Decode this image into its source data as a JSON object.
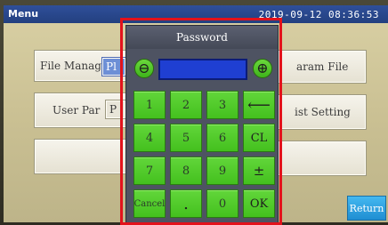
{
  "window": {
    "title": "Menu",
    "clock": "2019-09-12 08:36:53"
  },
  "menu": {
    "file_manager_label": "File Manag",
    "param_file_label": "aram File",
    "user_param_label": "User Par",
    "list_setting_label": "ist Setting",
    "return_label": "Return",
    "peek_label_1": "Pl",
    "peek_label_2": "P"
  },
  "password_dialog": {
    "title": "Password",
    "minus_symbol": "⊖",
    "plus_symbol": "⊕",
    "value": "",
    "keys": {
      "k1": "1",
      "k2": "2",
      "k3": "3",
      "backspace": "⟵",
      "k4": "4",
      "k5": "5",
      "k6": "6",
      "clear": "CL",
      "k7": "7",
      "k8": "8",
      "k9": "9",
      "sign": "±",
      "cancel": "Cancel",
      "dot": ".",
      "k0": "0",
      "ok": "OK"
    }
  },
  "colors": {
    "titlebar": "#2f4f9a",
    "screen_bg": "#d9d0a4",
    "key_green": "#44c01e",
    "password_field": "#1f3fd2",
    "return_blue": "#1f8ed2",
    "highlight_frame": "#e3121b"
  }
}
